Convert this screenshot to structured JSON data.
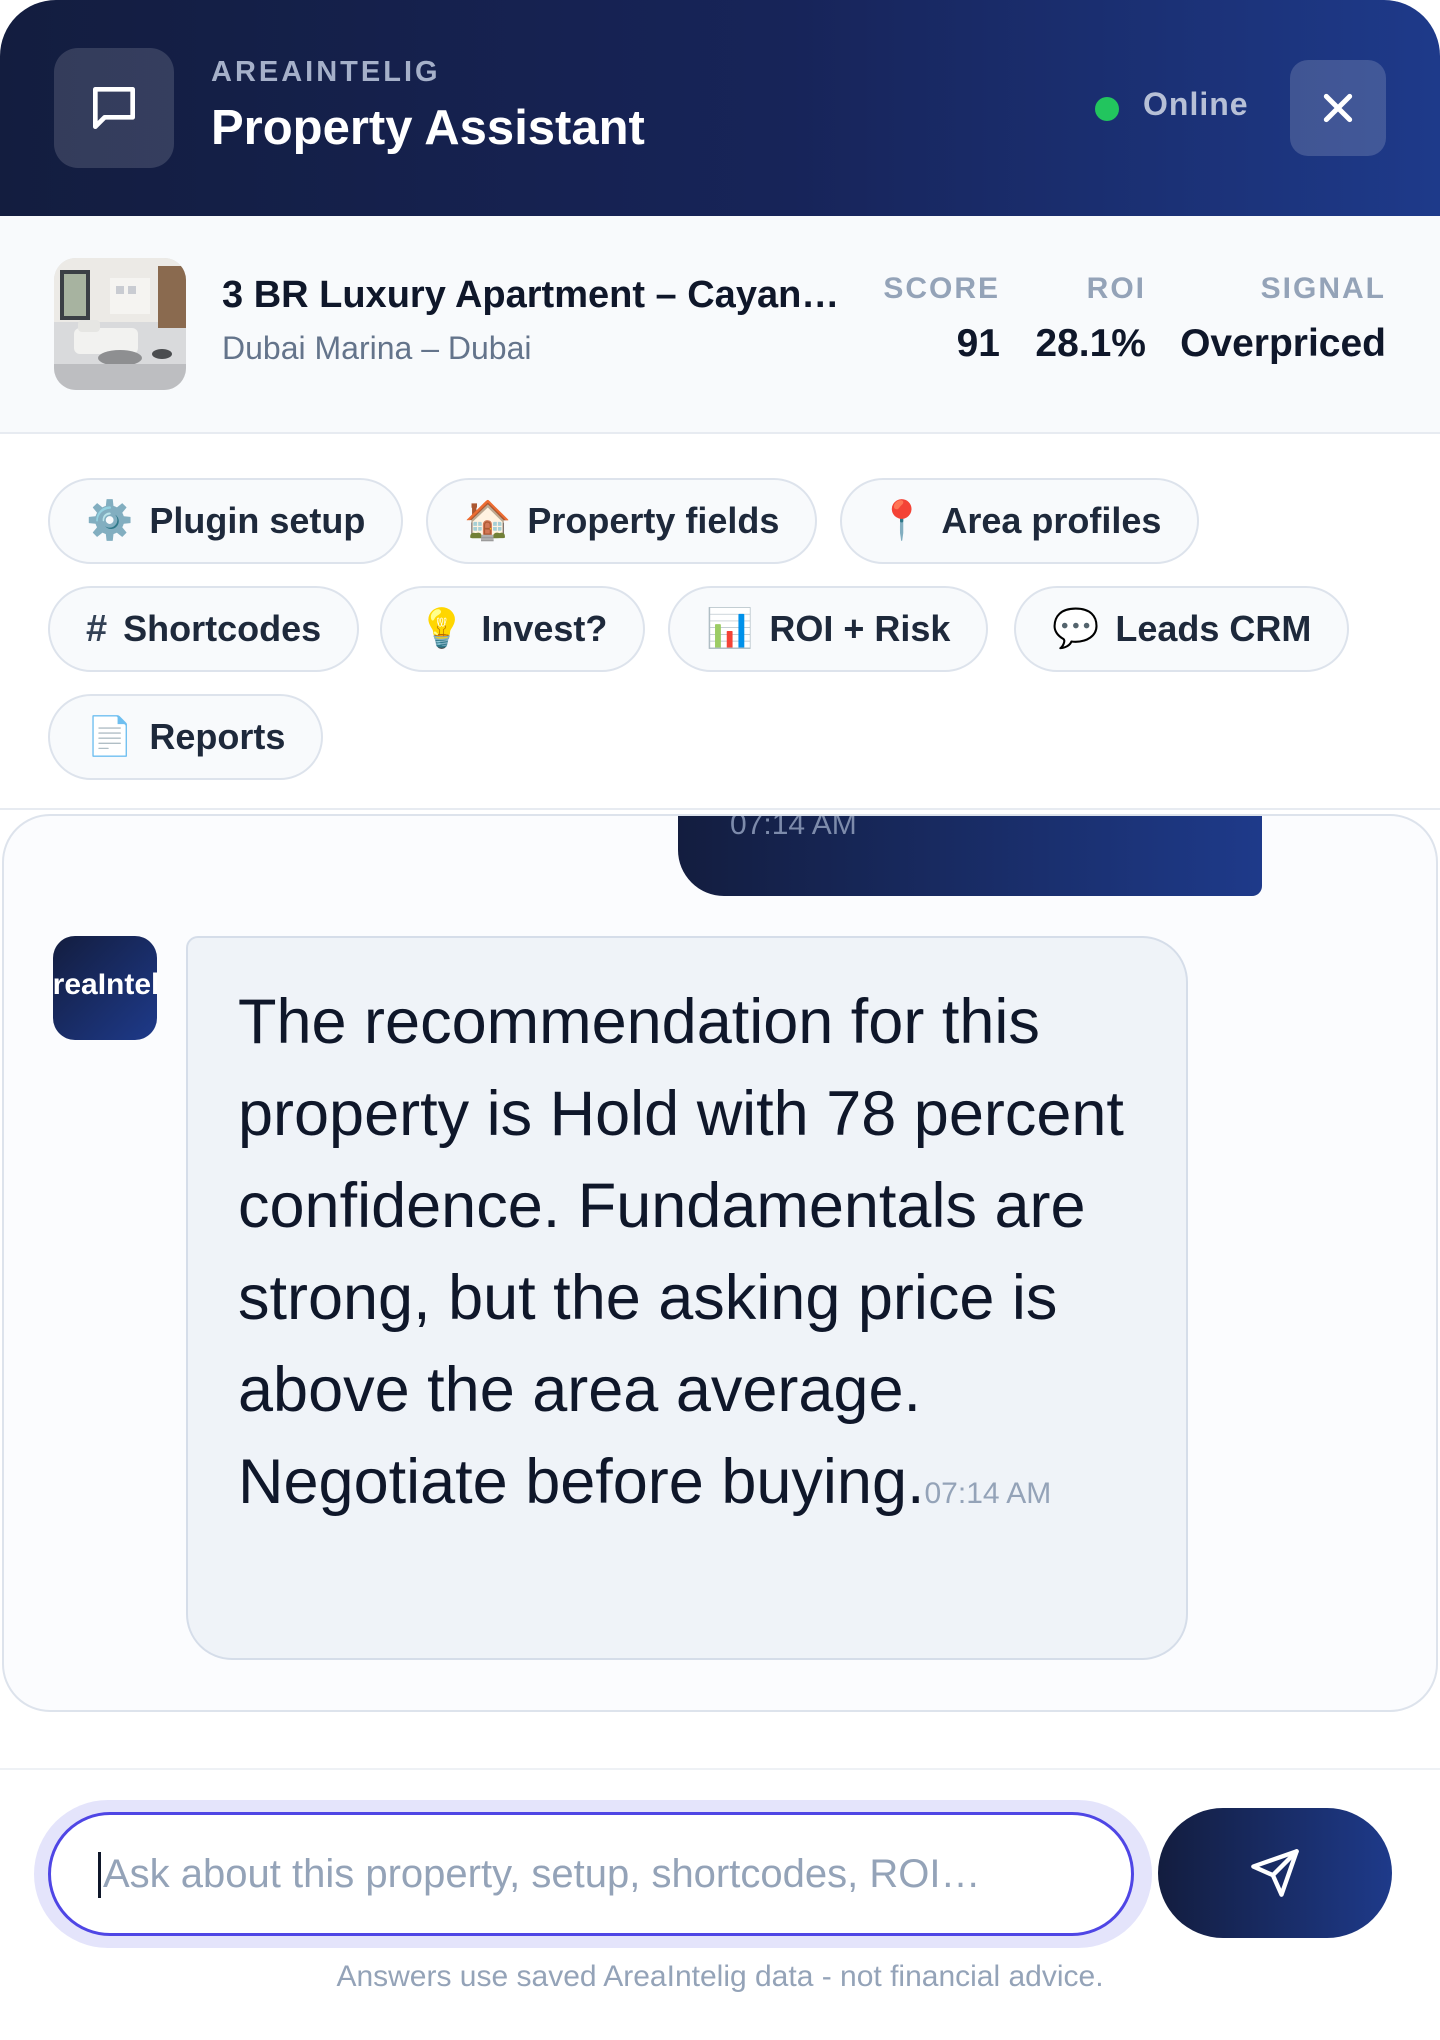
{
  "header": {
    "brand": "AREAINTELIG",
    "title": "Property Assistant",
    "status": "Online"
  },
  "property": {
    "name": "3 BR Luxury Apartment – Cayan…",
    "location": "Dubai Marina – Dubai",
    "stats": [
      {
        "label": "SCORE",
        "value": "91"
      },
      {
        "label": "ROI",
        "value": "28.1%"
      },
      {
        "label": "SIGNAL",
        "value": "Overpriced"
      }
    ]
  },
  "chips": [
    {
      "icon": "⚙️",
      "label": "Plugin setup"
    },
    {
      "icon": "🏠",
      "label": "Property fields"
    },
    {
      "icon": "📍",
      "label": "Area profiles"
    },
    {
      "icon": "#",
      "label": "Shortcodes"
    },
    {
      "icon": "💡",
      "label": "Invest?"
    },
    {
      "icon": "📊",
      "label": "ROI + Risk"
    },
    {
      "icon": "💬",
      "label": "Leads CRM"
    },
    {
      "icon": "📄",
      "label": "Reports"
    }
  ],
  "chat": {
    "user_message_time": "07:14 AM",
    "bot_avatar_text": "AreaIntel",
    "bot_message": "The recommendation for this property is Hold with 78 percent confidence. Fundamentals are strong, but the asking price is above the area average. Negotiate before buying.",
    "bot_message_time": "07:14 AM"
  },
  "composer": {
    "placeholder": "Ask about this property, setup, shortcodes, ROI…",
    "disclaimer": "Answers use saved AreaIntelig data - not financial advice."
  },
  "colors": {
    "header_start": "#131d3f",
    "header_end": "#1e3a8a",
    "online": "#22c55e",
    "input_focus": "#4f46e5"
  }
}
